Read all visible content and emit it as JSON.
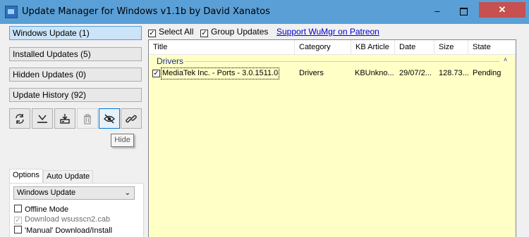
{
  "window": {
    "title": "Update Manager for Windows v1.1b by David Xanatos",
    "minimize": "–",
    "close": "✕"
  },
  "nav": {
    "items": [
      {
        "label": "Windows Update (1)",
        "active": true
      },
      {
        "label": "Installed Updates (5)",
        "active": false
      },
      {
        "label": "Hidden Updates (0)",
        "active": false
      },
      {
        "label": "Update History (92)",
        "active": false
      }
    ]
  },
  "toolbar": {
    "icons": [
      "refresh-icon",
      "download-icon",
      "install-icon",
      "delete-icon",
      "hide-icon",
      "link-icon"
    ],
    "tooltip": "Hide"
  },
  "options": {
    "tabs": [
      "Options",
      "Auto Update"
    ],
    "source_value": "Windows Update",
    "chevron": "⌄",
    "checkboxes": [
      {
        "label": "Offline Mode",
        "checked": false,
        "disabled": false
      },
      {
        "label": "Download wsusscn2.cab",
        "checked": true,
        "disabled": true
      },
      {
        "label": "'Manual' Download/Install",
        "checked": false,
        "disabled": false
      }
    ]
  },
  "top": {
    "select_all": "Select All",
    "group_updates": "Group Updates",
    "patreon_link": "Support WuMgr on Patreon",
    "check_mark": "✓"
  },
  "list": {
    "columns": [
      "Title",
      "Category",
      "KB Article",
      "Date",
      "Size",
      "State"
    ],
    "group": "Drivers",
    "collapse_glyph": "˄",
    "rows": [
      {
        "checked": true,
        "title": "MediaTek Inc. - Ports - 3.0.1511.0",
        "category": "Drivers",
        "kb": "KBUnkno...",
        "date": "29/07/2...",
        "size": "128.73...",
        "state": "Pending"
      }
    ]
  },
  "colors": {
    "titlebar": "#5a9fd6",
    "list_background": "#ffffc6",
    "active_nav": "#cce4f7",
    "close_button": "#c75050"
  }
}
